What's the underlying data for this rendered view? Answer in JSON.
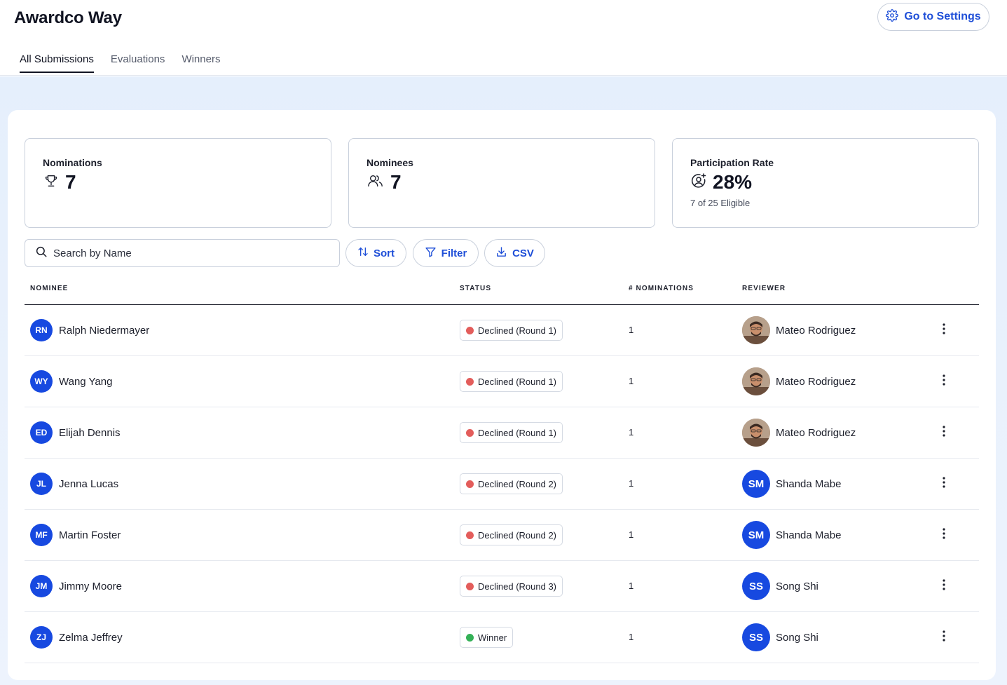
{
  "app": {
    "title": "Awardco Way",
    "settings_label": "Go to Settings"
  },
  "tabs": [
    {
      "label": "All Submissions",
      "active": true
    },
    {
      "label": "Evaluations",
      "active": false
    },
    {
      "label": "Winners",
      "active": false
    }
  ],
  "stats": {
    "nominations": {
      "label": "Nominations",
      "value": "7",
      "icon": "trophy-icon"
    },
    "nominees": {
      "label": "Nominees",
      "value": "7",
      "icon": "users-icon"
    },
    "participation": {
      "label": "Participation Rate",
      "value": "28%",
      "sub": "7 of 25 Eligible",
      "icon": "user-plus-icon"
    }
  },
  "toolbar": {
    "search_placeholder": "Search by Name",
    "sort_label": "Sort",
    "filter_label": "Filter",
    "csv_label": "CSV"
  },
  "columns": {
    "nominee": "NOMINEE",
    "status": "STATUS",
    "nominations": "# NOMINATIONS",
    "reviewer": "REVIEWER"
  },
  "colors": {
    "accent": "#1749e0",
    "declined": "#e35d5b",
    "winner": "#34b157"
  },
  "rows": [
    {
      "initials": "RN",
      "name": "Ralph Niedermayer",
      "status": "Declined (Round 1)",
      "status_type": "declined",
      "count": "1",
      "reviewer": "Mateo Rodriguez",
      "reviewer_initials": "",
      "reviewer_photo": true
    },
    {
      "initials": "WY",
      "name": "Wang Yang",
      "status": "Declined (Round 1)",
      "status_type": "declined",
      "count": "1",
      "reviewer": "Mateo Rodriguez",
      "reviewer_initials": "",
      "reviewer_photo": true
    },
    {
      "initials": "ED",
      "name": "Elijah Dennis",
      "status": "Declined (Round 1)",
      "status_type": "declined",
      "count": "1",
      "reviewer": "Mateo Rodriguez",
      "reviewer_initials": "",
      "reviewer_photo": true
    },
    {
      "initials": "JL",
      "name": "Jenna Lucas",
      "status": "Declined (Round 2)",
      "status_type": "declined",
      "count": "1",
      "reviewer": "Shanda Mabe",
      "reviewer_initials": "SM",
      "reviewer_photo": false
    },
    {
      "initials": "MF",
      "name": "Martin Foster",
      "status": "Declined (Round 2)",
      "status_type": "declined",
      "count": "1",
      "reviewer": "Shanda Mabe",
      "reviewer_initials": "SM",
      "reviewer_photo": false
    },
    {
      "initials": "JM",
      "name": "Jimmy Moore",
      "status": "Declined (Round 3)",
      "status_type": "declined",
      "count": "1",
      "reviewer": "Song Shi",
      "reviewer_initials": "SS",
      "reviewer_photo": false
    },
    {
      "initials": "ZJ",
      "name": "Zelma Jeffrey",
      "status": "Winner",
      "status_type": "winner",
      "count": "1",
      "reviewer": "Song Shi",
      "reviewer_initials": "SS",
      "reviewer_photo": false
    }
  ]
}
